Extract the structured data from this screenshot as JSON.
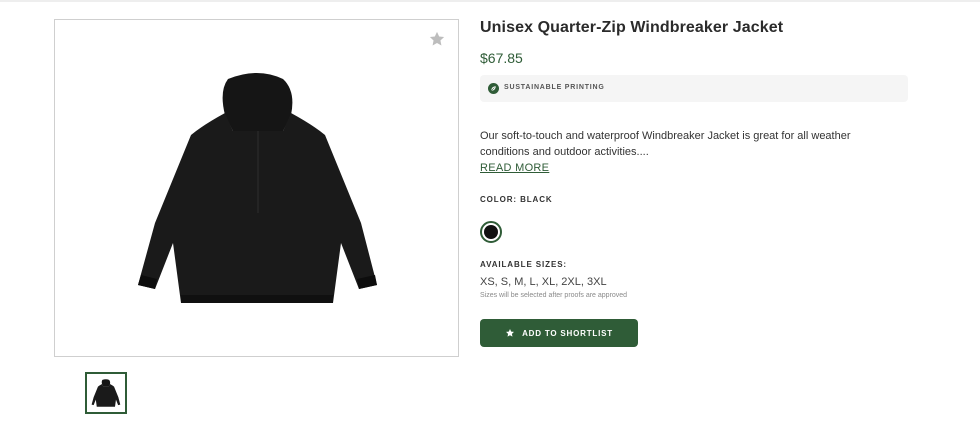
{
  "product": {
    "title": "Unisex Quarter-Zip Windbreaker Jacket",
    "price": "$67.85",
    "badge": "SUSTAINABLE PRINTING",
    "description": "Our soft-to-touch and waterproof Windbreaker Jacket is great for all weather conditions and outdoor activities....",
    "read_more": "READ MORE",
    "color_label": "COLOR: BLACK",
    "selected_color": "#111111",
    "sizes_label": "AVAILABLE SIZES:",
    "sizes": "XS, S, M, L, XL, 2XL, 3XL",
    "sizes_note": "Sizes will be selected after proofs are approved",
    "shortlist_button": "ADD TO SHORTLIST"
  },
  "icons": {
    "favorite": "star-icon",
    "badge": "leaf-icon",
    "button": "star-icon"
  },
  "colors": {
    "accent": "#2f5c37",
    "badge_bg": "#f5f5f5"
  }
}
